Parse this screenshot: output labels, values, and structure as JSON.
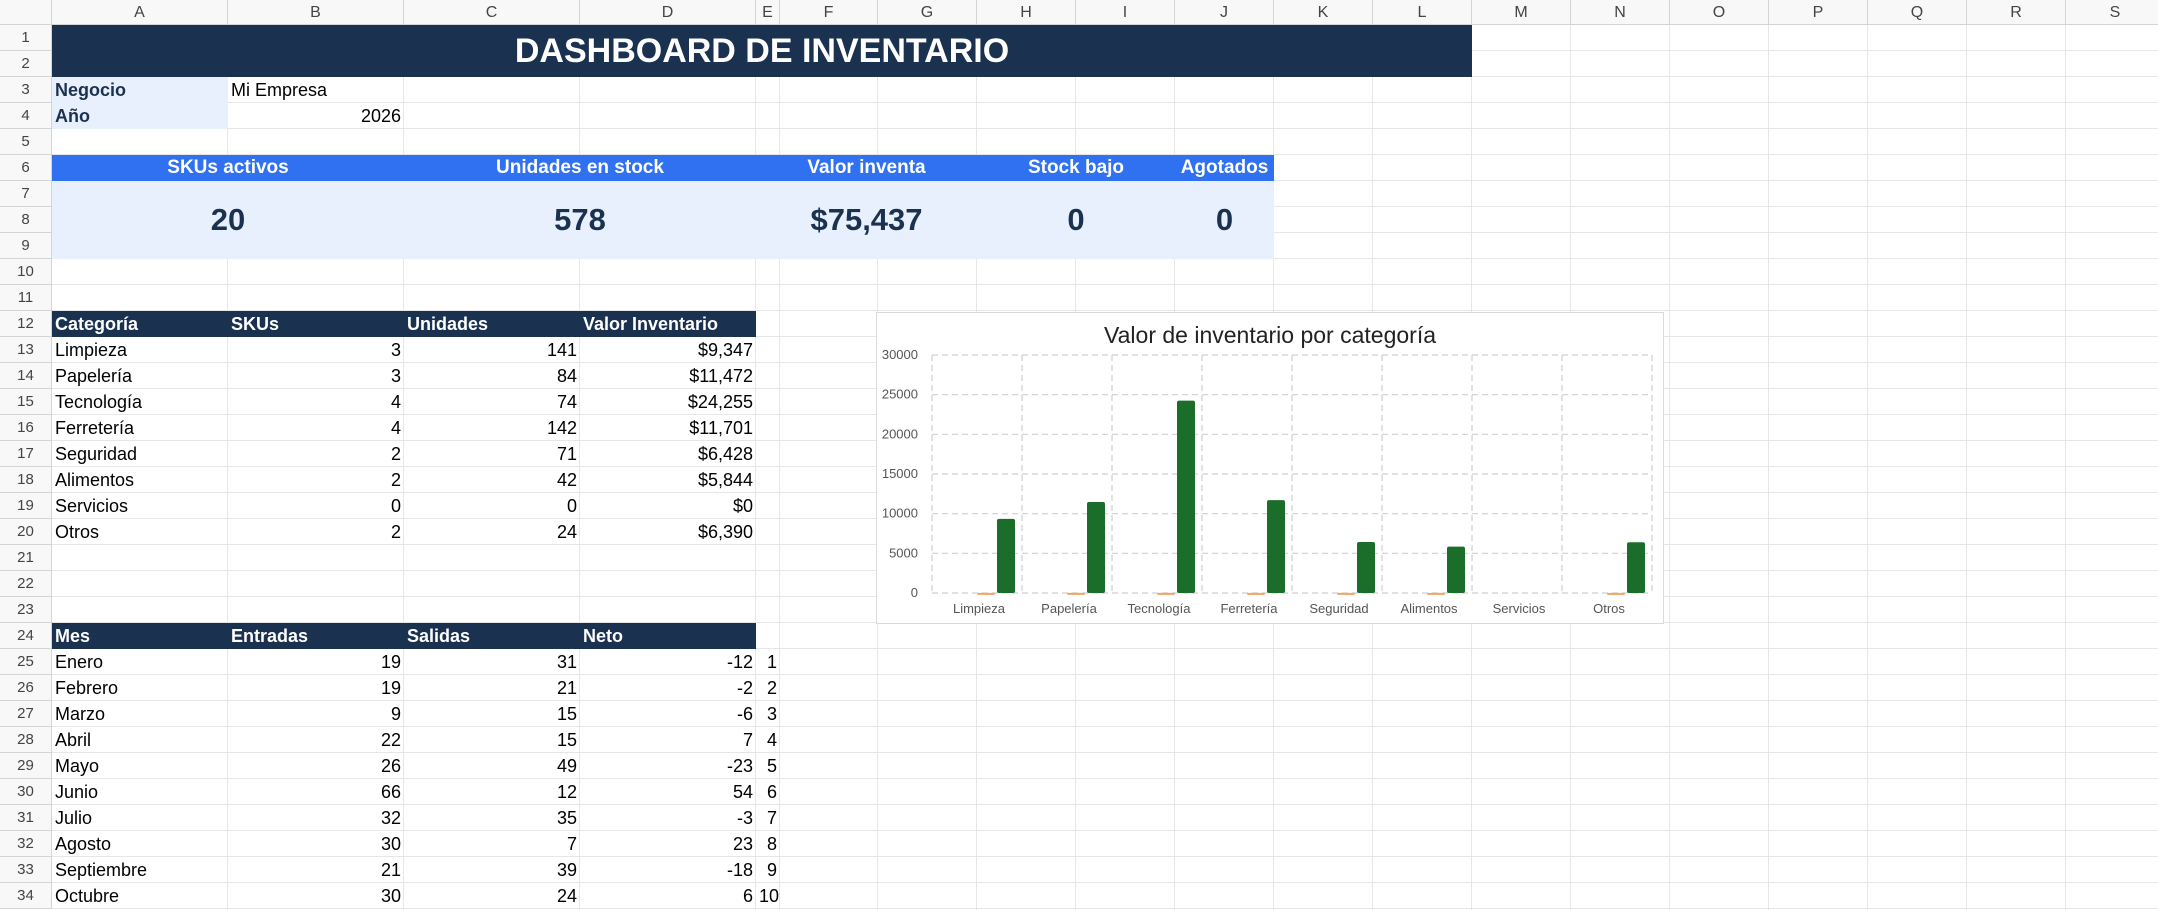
{
  "columns": [
    "A",
    "B",
    "C",
    "D",
    "E",
    "F",
    "G",
    "H",
    "I",
    "J",
    "K",
    "L",
    "M",
    "N",
    "O",
    "P",
    "Q",
    "R",
    "S"
  ],
  "rows": [
    "1",
    "2",
    "3",
    "4",
    "5",
    "6",
    "7",
    "8",
    "9",
    "10",
    "11",
    "12",
    "13",
    "14",
    "15",
    "16",
    "17",
    "18",
    "19",
    "20",
    "21",
    "22",
    "23",
    "24",
    "25",
    "26",
    "27",
    "28",
    "29",
    "30",
    "31",
    "32",
    "33",
    "34"
  ],
  "title": "DASHBOARD DE INVENTARIO",
  "business": {
    "label": "Negocio",
    "value": "Mi Empresa"
  },
  "year": {
    "label": "Año",
    "value": "2026"
  },
  "kpis": [
    {
      "label": "SKUs activos",
      "value": "20"
    },
    {
      "label": "Unidades en stock",
      "value": "578"
    },
    {
      "label": "Valor inventa",
      "value": "$75,437"
    },
    {
      "label": "Stock bajo",
      "value": "0"
    },
    {
      "label": "Agotados",
      "value": "0"
    }
  ],
  "category_table": {
    "headers": [
      "Categoría",
      "SKUs",
      "Unidades",
      "Valor Inventario"
    ],
    "rows": [
      [
        "Limpieza",
        "3",
        "141",
        "$9,347"
      ],
      [
        "Papelería",
        "3",
        "84",
        "$11,472"
      ],
      [
        "Tecnología",
        "4",
        "74",
        "$24,255"
      ],
      [
        "Ferretería",
        "4",
        "142",
        "$11,701"
      ],
      [
        "Seguridad",
        "2",
        "71",
        "$6,428"
      ],
      [
        "Alimentos",
        "2",
        "42",
        "$5,844"
      ],
      [
        "Servicios",
        "0",
        "0",
        "$0"
      ],
      [
        "Otros",
        "2",
        "24",
        "$6,390"
      ]
    ]
  },
  "month_table": {
    "headers": [
      "Mes",
      "Entradas",
      "Salidas",
      "Neto"
    ],
    "rows": [
      [
        "Enero",
        "19",
        "31",
        "-12",
        "1"
      ],
      [
        "Febrero",
        "19",
        "21",
        "-2",
        "2"
      ],
      [
        "Marzo",
        "9",
        "15",
        "-6",
        "3"
      ],
      [
        "Abril",
        "22",
        "15",
        "7",
        "4"
      ],
      [
        "Mayo",
        "26",
        "49",
        "-23",
        "5"
      ],
      [
        "Junio",
        "66",
        "12",
        "54",
        "6"
      ],
      [
        "Julio",
        "32",
        "35",
        "-3",
        "7"
      ],
      [
        "Agosto",
        "30",
        "7",
        "23",
        "8"
      ],
      [
        "Septiembre",
        "21",
        "39",
        "-18",
        "9"
      ],
      [
        "Octubre",
        "30",
        "24",
        "6",
        "10"
      ]
    ]
  },
  "chart_data": {
    "type": "bar",
    "title": "Valor de inventario por categoría",
    "categories": [
      "Limpieza",
      "Papelería",
      "Tecnología",
      "Ferretería",
      "Seguridad",
      "Alimentos",
      "Servicios",
      "Otros"
    ],
    "series": [
      {
        "values": [
          20,
          10,
          10,
          20,
          10,
          10,
          0,
          10
        ],
        "color": "#f4a261"
      },
      {
        "values": [
          9347,
          11472,
          24255,
          11701,
          6428,
          5844,
          0,
          6390
        ],
        "color": "#1b6e2a"
      }
    ],
    "ylim": [
      0,
      30000
    ],
    "yticks": [
      "0",
      "5000",
      "10000",
      "15000",
      "20000",
      "25000",
      "30000"
    ],
    "grid": true
  },
  "colors": {
    "navy": "#1a3150",
    "kpi_header": "#2f71f0",
    "kpi_bg": "#e8f0fd",
    "label_bg": "#e8f0fd"
  }
}
